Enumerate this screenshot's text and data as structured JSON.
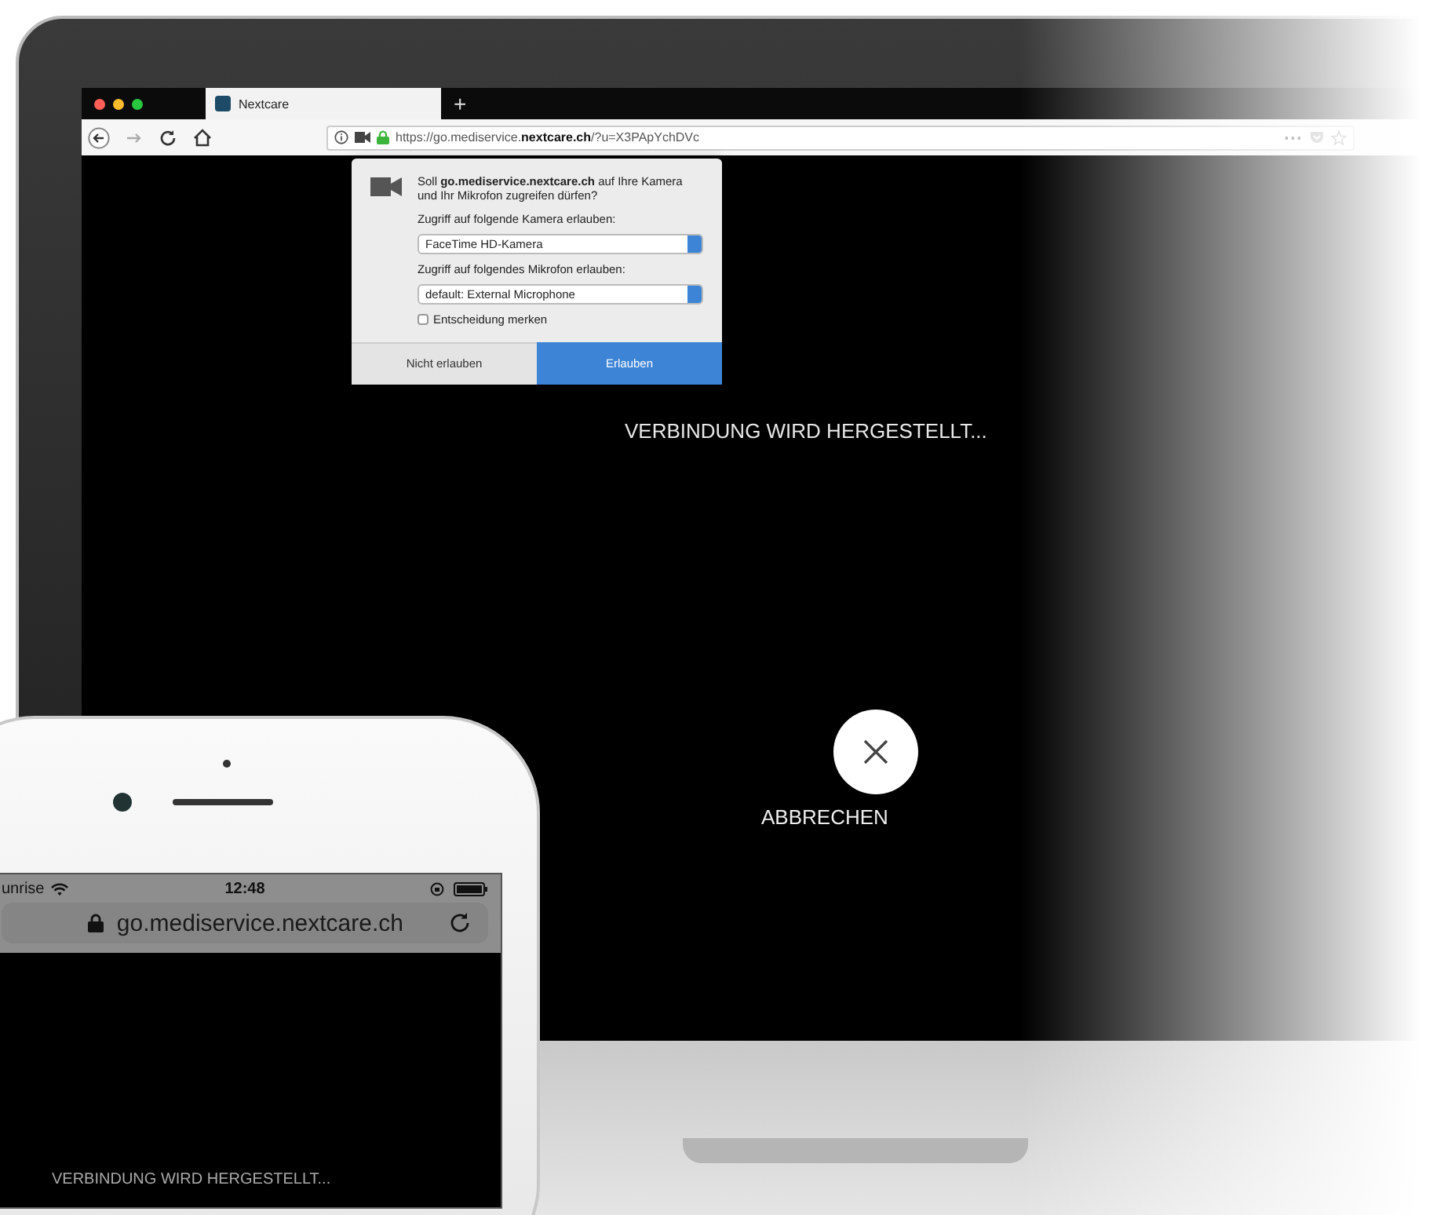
{
  "laptop": {
    "browser": {
      "tabs": [
        {
          "label": "Nextcare",
          "selected": true
        }
      ],
      "new_tab": "+",
      "url": "https://go.mediservice.**nextcare.ch**/?u=X3PApYchDVc",
      "more": "···"
    },
    "permission_popup": {
      "message": "Soll **go.mediservice.nextcare.ch** auf Ihre Kamera und Ihr Mikrofon zugreifen dürfen?",
      "camera_label": "Zugriff auf folgende Kamera erlauben:",
      "camera_value": "FaceTime HD-Kamera",
      "microphone_label": "Zugriff auf folgendes Mikrofon erlauben:",
      "microphone_value": "default: External Microphone",
      "remember": {
        "label": "Entscheidung merken",
        "checked": false
      },
      "buttons": [
        {
          "label": "Nicht erlauben",
          "primary": false
        },
        {
          "label": "Erlauben",
          "primary": true
        }
      ]
    },
    "status": "VERBINDUNG WIRD HERGESTELLT...",
    "cancel_label": "ABBRECHEN"
  },
  "phone": {
    "carrier": "unrise",
    "time": "12:48",
    "url": "go.mediservice.nextcare.ch",
    "status": "VERBINDUNG WIRD HERGESTELLT..."
  }
}
